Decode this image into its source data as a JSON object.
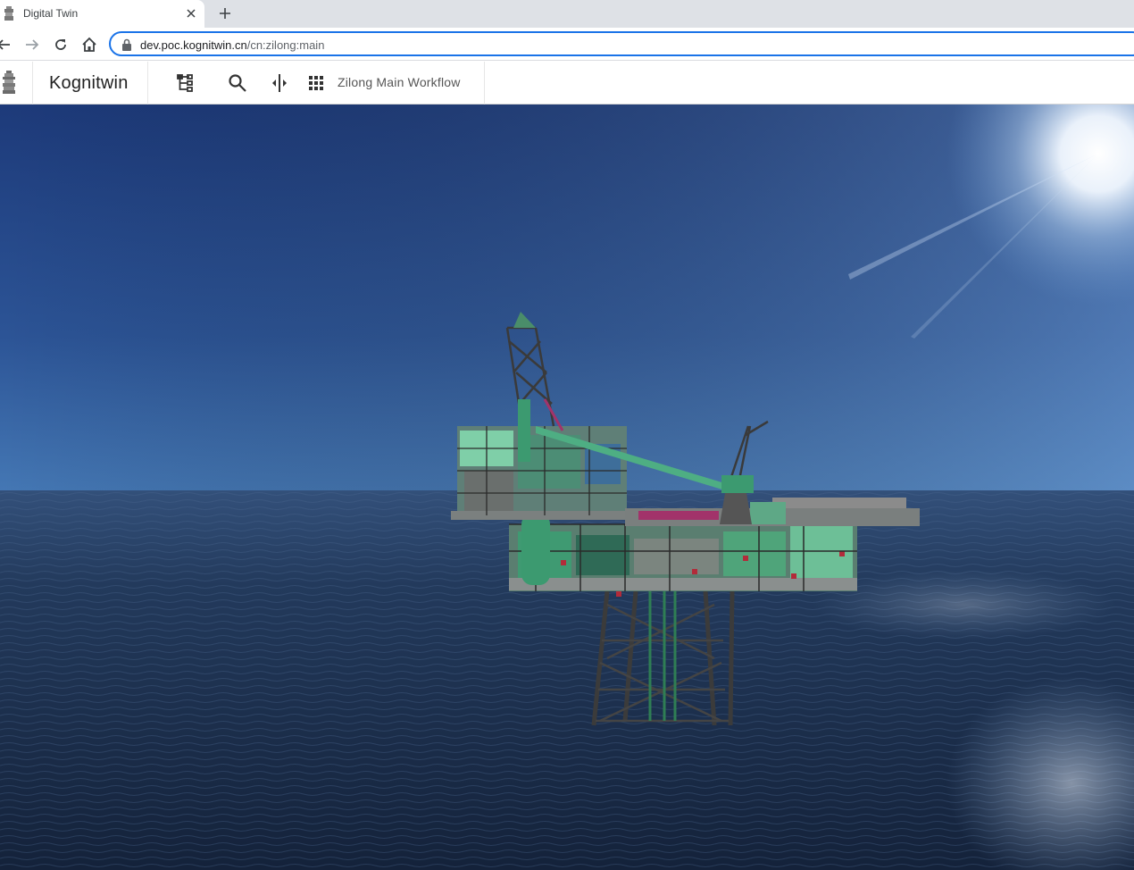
{
  "browser": {
    "tab": {
      "title": "Digital Twin",
      "favicon": "kognitwin-favicon-icon"
    },
    "url": {
      "host": "dev.poc.kognitwin.cn",
      "path": "/cn:zilong:main"
    },
    "icons": [
      "back-arrow-icon",
      "forward-arrow-icon",
      "reload-icon",
      "home-icon",
      "lock-icon",
      "close-icon",
      "plus-icon"
    ]
  },
  "app": {
    "brand": "Kognitwin",
    "toolbar_icons": [
      "hierarchy-tree-icon",
      "search-icon",
      "split-view-icon",
      "apps-grid-icon"
    ],
    "workflow_label": "Zilong Main Workflow"
  },
  "scene": {
    "description_icon": "offshore-platform-3d-model",
    "colors": {
      "sky_top": "#1f3c7c",
      "sky_horizon": "#3f70b0",
      "sea_near": "#1a2a44",
      "sea_far": "#2a3f62",
      "platform_green": "#3c9a70",
      "steel": "#3a3a3a"
    }
  }
}
